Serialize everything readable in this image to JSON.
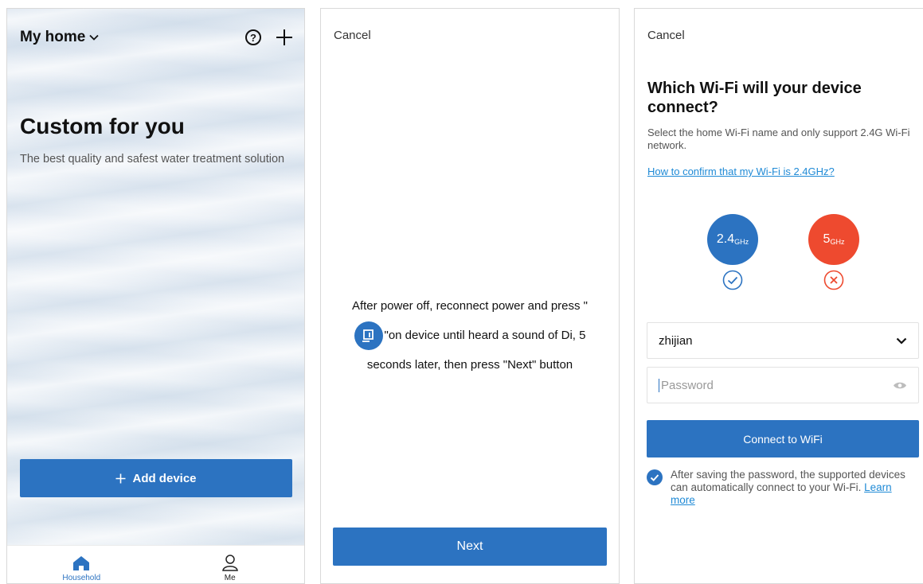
{
  "screen1": {
    "home_title": "My home",
    "hero_title": "Custom for you",
    "hero_subtitle": "The best quality and safest water treatment solution",
    "add_device_label": "Add device",
    "tabs": [
      {
        "label": "Household",
        "icon": "home-icon",
        "active": true
      },
      {
        "label": "Me",
        "icon": "person-icon",
        "active": false
      }
    ]
  },
  "screen2": {
    "cancel_label": "Cancel",
    "instruction_line1": "After power off, reconnect power and press \"",
    "instruction_line2": "\"on device until heard a sound of Di, 5",
    "instruction_line3": "seconds later, then press \"Next\" button",
    "next_label": "Next"
  },
  "screen3": {
    "cancel_label": "Cancel",
    "title": "Which Wi-Fi will your device connect?",
    "description": "Select the home Wi-Fi name and only support 2.4G Wi-Fi network.",
    "help_link": "How to confirm that my Wi-Fi is 2.4GHz?",
    "band_24_value": "2.4",
    "band_24_unit": "GHz",
    "band_5_value": "5",
    "band_5_unit": "GHz",
    "ssid_value": "zhijian",
    "password_placeholder": "Password",
    "connect_label": "Connect to WiFi",
    "save_note": "After saving the password, the supported devices can automatically connect to your Wi-Fi.",
    "learn_more": "Learn more"
  },
  "colors": {
    "primary": "#2c73c1",
    "danger": "#ee4a2f",
    "link": "#1f8ad6"
  }
}
